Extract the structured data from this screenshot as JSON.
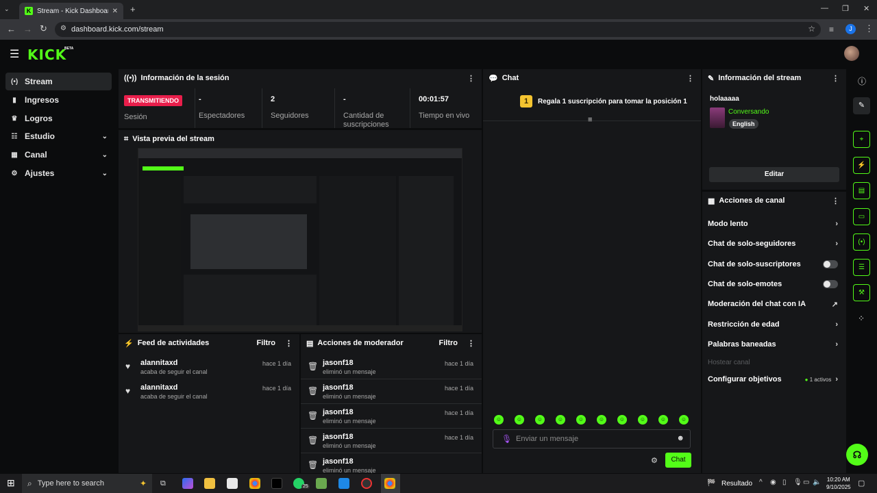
{
  "browser": {
    "tab_title": "Stream - Kick Dashboard",
    "url": "dashboard.kick.com/stream",
    "profile_initial": "J"
  },
  "app": {
    "logo": "KICK",
    "logo_badge": "BETA"
  },
  "nav": {
    "items": [
      {
        "label": "Stream",
        "icon": "stream-icon"
      },
      {
        "label": "Ingresos",
        "icon": "chart-icon"
      },
      {
        "label": "Logros",
        "icon": "trophy-icon"
      },
      {
        "label": "Estudio",
        "icon": "sliders-icon"
      },
      {
        "label": "Canal",
        "icon": "grid-icon"
      },
      {
        "label": "Ajustes",
        "icon": "gear-icon"
      }
    ]
  },
  "session": {
    "title": "Información de la sesión",
    "live_badge": "TRANSMITIENDO",
    "session_label": "Sesión",
    "stats": [
      {
        "value": "-",
        "label": "Espectadores"
      },
      {
        "value": "2",
        "label": "Seguidores"
      },
      {
        "value": "-",
        "label": "Cantidad de suscripciones"
      },
      {
        "value": "00:01:57",
        "label": "Tiempo en vivo"
      }
    ]
  },
  "preview": {
    "title": "Vista previa del stream"
  },
  "activity": {
    "title": "Feed de actividades",
    "filter": "Filtro",
    "items": [
      {
        "user": "alannitaxd",
        "desc": "acaba de seguir el canal",
        "time": "hace 1 día"
      },
      {
        "user": "alannitaxd",
        "desc": "acaba de seguir el canal",
        "time": "hace 1 día"
      }
    ]
  },
  "moderator": {
    "title": "Acciones de moderador",
    "filter": "Filtro",
    "items": [
      {
        "user": "jasonf18",
        "desc": "eliminó un mensaje",
        "time": "hace 1 día"
      },
      {
        "user": "jasonf18",
        "desc": "eliminó un mensaje",
        "time": "hace 1 día"
      },
      {
        "user": "jasonf18",
        "desc": "eliminó un mensaje",
        "time": "hace 1 día"
      },
      {
        "user": "jasonf18",
        "desc": "eliminó un mensaje",
        "time": "hace 1 día"
      },
      {
        "user": "jasonf18",
        "desc": "eliminó un mensaje",
        "time": ""
      }
    ]
  },
  "chat": {
    "title": "Chat",
    "gift_rank": "1",
    "gift_text": "Regala 1 suscripción para tomar la posición 1",
    "input_placeholder": "Enviar un mensaje",
    "send_label": "Chat"
  },
  "stream_info": {
    "title": "Información del stream",
    "stream_title": "holaaaaa",
    "category": "Conversando",
    "language": "English",
    "edit_label": "Editar"
  },
  "channel_actions": {
    "title": "Acciones de canal",
    "items": [
      {
        "label": "Modo lento",
        "control": "chevron"
      },
      {
        "label": "Chat de solo-seguidores",
        "control": "chevron"
      },
      {
        "label": "Chat de solo-suscriptores",
        "control": "toggle"
      },
      {
        "label": "Chat de solo-emotes",
        "control": "toggle"
      },
      {
        "label": "Moderación del chat con IA",
        "control": "external"
      },
      {
        "label": "Restricción de edad",
        "control": "chevron"
      },
      {
        "label": "Palabras baneadas",
        "control": "chevron"
      }
    ],
    "host_label": "Hostear canal",
    "goals_label": "Configurar objetivos",
    "goals_status": "1 activos"
  },
  "taskbar": {
    "search_placeholder": "Type here to search",
    "whatsapp_badge": "25",
    "weather_label": "Resultado",
    "time": "10:20 AM",
    "date": "9/10/2025"
  },
  "colors": {
    "accent": "#53fc18",
    "live": "#e91e4b",
    "panel": "#161719"
  }
}
